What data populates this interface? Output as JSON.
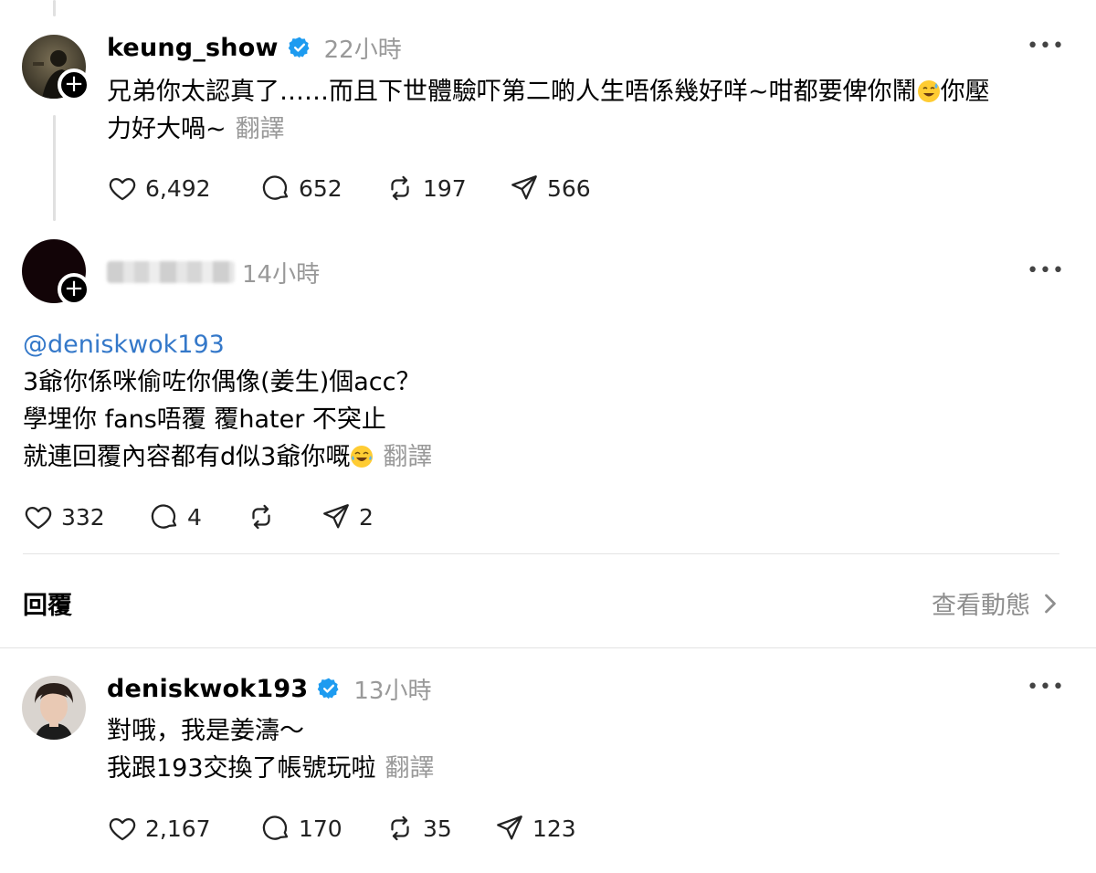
{
  "posts": [
    {
      "username": "keung_show",
      "verified": true,
      "time": "22小時",
      "lines": [
        "兄弟你太認真了……而且下世體驗吓第二啲人生唔係幾好咩~咁都要俾你鬧",
        "你壓",
        "力好大喎~"
      ],
      "translate": "翻譯",
      "likes": "6,492",
      "comments": "652",
      "reposts": "197",
      "shares": "566"
    },
    {
      "username_blurred": true,
      "time": "14小時",
      "mention": "@deniskwok193",
      "lines": [
        "3爺你係咪偷咗你偶像(姜生)個acc？",
        "學埋你 fans唔覆 覆hater 不突止",
        "就連回覆內容都有d似3爺你嘅"
      ],
      "translate": "翻譯",
      "likes": "332",
      "comments": "4",
      "reposts": "",
      "shares": "2"
    },
    {
      "username": "deniskwok193",
      "verified": true,
      "time": "13小時",
      "lines": [
        "對哦，我是姜濤～",
        "我跟193交換了帳號玩啦"
      ],
      "translate": "翻譯",
      "likes": "2,167",
      "comments": "170",
      "reposts": "35",
      "shares": "123"
    }
  ],
  "replies_section": {
    "title": "回覆",
    "view_activity": "查看動態"
  },
  "icons": [
    "heart-icon",
    "comment-icon",
    "repost-icon",
    "share-icon",
    "verified-icon",
    "more-icon",
    "chevron-right-icon",
    "plus-icon"
  ],
  "colors": {
    "verified": "#1d9bf0",
    "mention": "#3478c9",
    "muted": "#999999"
  }
}
